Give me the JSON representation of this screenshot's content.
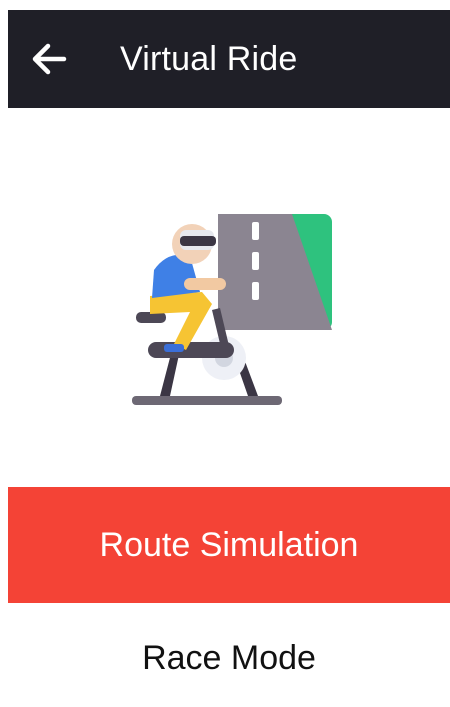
{
  "appbar": {
    "title": "Virtual Ride",
    "back_icon": "arrow-left-icon"
  },
  "illustration": {
    "icon": "vr-cyclist-illustration"
  },
  "menu": {
    "route_simulation_label": "Route Simulation",
    "race_mode_label": "Race Mode"
  },
  "colors": {
    "appbar_bg": "#1f1f27",
    "primary_button_bg": "#f44336",
    "primary_button_text": "#ffffff",
    "secondary_text": "#111111"
  }
}
